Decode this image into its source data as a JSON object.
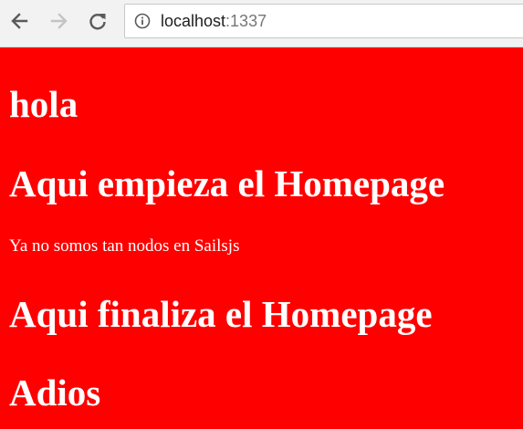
{
  "browser": {
    "url_host": "localhost",
    "url_port": ":1337",
    "icons": {
      "back": "back-arrow-icon",
      "forward": "forward-arrow-icon",
      "reload": "reload-icon",
      "site_info": "info-icon"
    }
  },
  "page": {
    "background_color": "#ff0000",
    "text_color": "#ffffff",
    "heading_1": "hola",
    "heading_2": "Aqui empieza el Homepage",
    "paragraph": "Ya no somos tan nodos en Sailsjs",
    "heading_3": "Aqui finaliza el Homepage",
    "heading_4": "Adios"
  }
}
